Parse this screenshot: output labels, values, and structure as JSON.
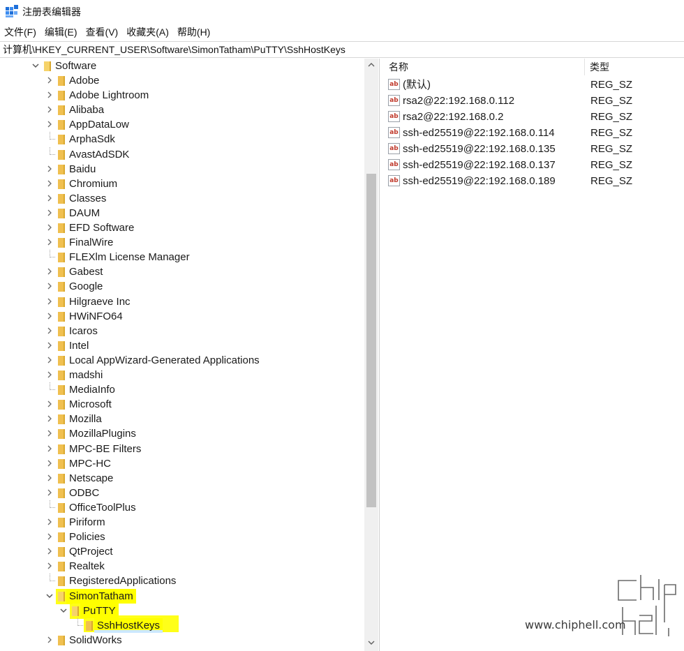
{
  "window": {
    "title": "注册表编辑器"
  },
  "menu": [
    "文件(F)",
    "编辑(E)",
    "查看(V)",
    "收藏夹(A)",
    "帮助(H)"
  ],
  "address": "计算机\\HKEY_CURRENT_USER\\Software\\SimonTatham\\PuTTY\\SshHostKeys",
  "tree": {
    "root": "Software",
    "children": [
      {
        "label": "Adobe",
        "expandable": true
      },
      {
        "label": "Adobe Lightroom",
        "expandable": true
      },
      {
        "label": "Alibaba",
        "expandable": true
      },
      {
        "label": "AppDataLow",
        "expandable": true
      },
      {
        "label": "ArphaSdk",
        "expandable": false
      },
      {
        "label": "AvastAdSDK",
        "expandable": false
      },
      {
        "label": "Baidu",
        "expandable": true
      },
      {
        "label": "Chromium",
        "expandable": true
      },
      {
        "label": "Classes",
        "expandable": true
      },
      {
        "label": "DAUM",
        "expandable": true
      },
      {
        "label": "EFD Software",
        "expandable": true
      },
      {
        "label": "FinalWire",
        "expandable": true
      },
      {
        "label": "FLEXlm License Manager",
        "expandable": false
      },
      {
        "label": "Gabest",
        "expandable": true
      },
      {
        "label": "Google",
        "expandable": true
      },
      {
        "label": "Hilgraeve Inc",
        "expandable": true
      },
      {
        "label": "HWiNFO64",
        "expandable": true
      },
      {
        "label": "Icaros",
        "expandable": true
      },
      {
        "label": "Intel",
        "expandable": true
      },
      {
        "label": "Local AppWizard-Generated Applications",
        "expandable": true
      },
      {
        "label": "madshi",
        "expandable": true
      },
      {
        "label": "MediaInfo",
        "expandable": false
      },
      {
        "label": "Microsoft",
        "expandable": true
      },
      {
        "label": "Mozilla",
        "expandable": true
      },
      {
        "label": "MozillaPlugins",
        "expandable": true
      },
      {
        "label": "MPC-BE Filters",
        "expandable": true
      },
      {
        "label": "MPC-HC",
        "expandable": true
      },
      {
        "label": "Netscape",
        "expandable": true
      },
      {
        "label": "ODBC",
        "expandable": true
      },
      {
        "label": "OfficeToolPlus",
        "expandable": false
      },
      {
        "label": "Piriform",
        "expandable": true
      },
      {
        "label": "Policies",
        "expandable": true
      },
      {
        "label": "QtProject",
        "expandable": true
      },
      {
        "label": "Realtek",
        "expandable": true
      },
      {
        "label": "RegisteredApplications",
        "expandable": false
      },
      {
        "label": "SimonTatham",
        "expandable": true,
        "expanded": true,
        "highlight": true
      },
      {
        "label": "PuTTY",
        "expandable": true,
        "expanded": true,
        "highlight": true,
        "depth": 1
      },
      {
        "label": "SshHostKeys",
        "expandable": false,
        "selected": true,
        "highlight": true,
        "depth": 2
      },
      {
        "label": "SolidWorks",
        "expandable": true
      }
    ]
  },
  "list": {
    "headers": {
      "name": "名称",
      "type": "类型"
    },
    "rows": [
      {
        "name": "(默认)",
        "type": "REG_SZ"
      },
      {
        "name": "rsa2@22:192.168.0.112",
        "type": "REG_SZ"
      },
      {
        "name": "rsa2@22:192.168.0.2",
        "type": "REG_SZ"
      },
      {
        "name": "ssh-ed25519@22:192.168.0.114",
        "type": "REG_SZ"
      },
      {
        "name": "ssh-ed25519@22:192.168.0.135",
        "type": "REG_SZ"
      },
      {
        "name": "ssh-ed25519@22:192.168.0.137",
        "type": "REG_SZ"
      },
      {
        "name": "ssh-ed25519@22:192.168.0.189",
        "type": "REG_SZ"
      }
    ],
    "icon_text": "ab"
  },
  "watermark": {
    "url": "www.chiphell.com",
    "logo_text": "chip hell"
  },
  "colors": {
    "highlight": "#ffff00",
    "selection": "#cce8ff",
    "folder": "#f0c050"
  }
}
